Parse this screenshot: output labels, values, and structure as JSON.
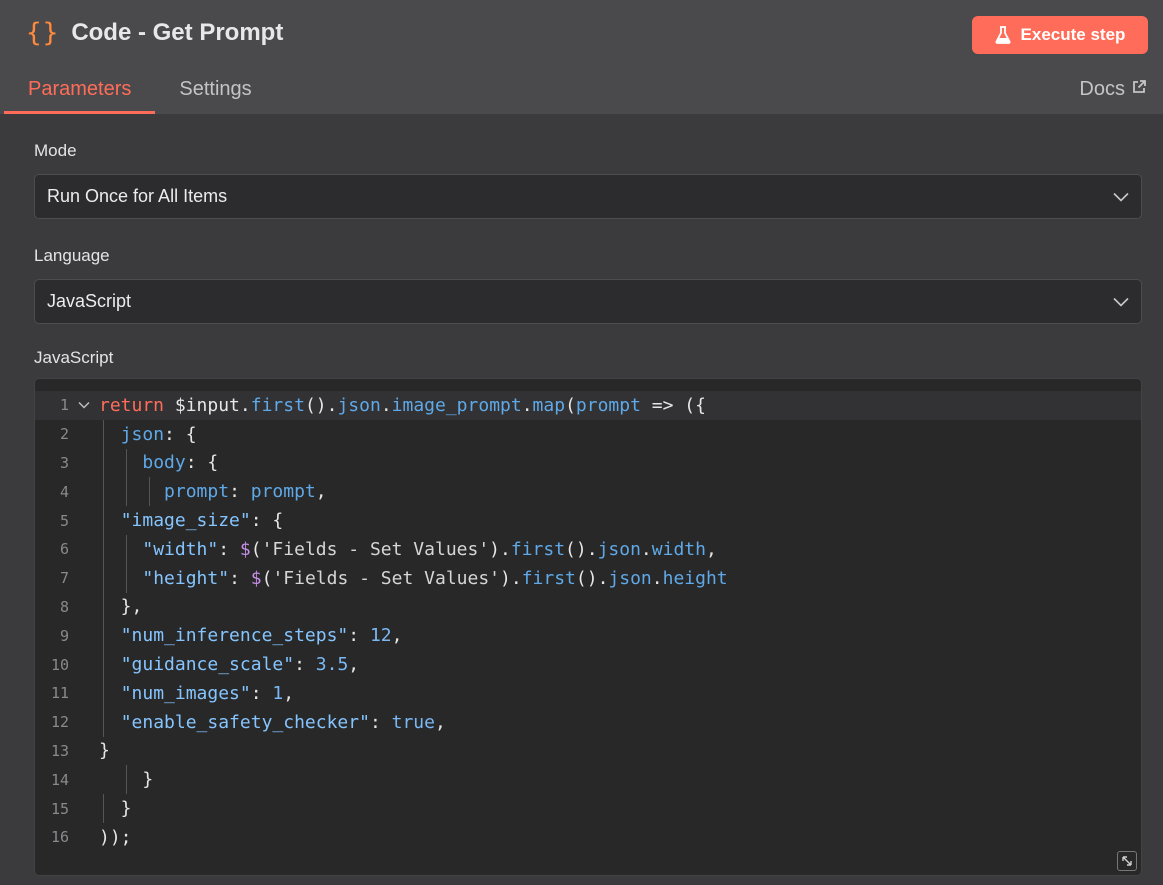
{
  "header": {
    "icon": "code-braces-icon",
    "icon_glyph": "{}",
    "title": "Code - Get Prompt",
    "execute_label": "Execute step",
    "accent": "#ff6d5a"
  },
  "tabs": [
    {
      "label": "Parameters",
      "active": true
    },
    {
      "label": "Settings",
      "active": false
    }
  ],
  "docs_label": "Docs",
  "mode": {
    "label": "Mode",
    "value": "Run Once for All Items"
  },
  "language": {
    "label": "Language",
    "value": "JavaScript"
  },
  "editor": {
    "label": "JavaScript",
    "lines": [
      {
        "n": "1",
        "text": "return $input.first().json.image_prompt.map(prompt => ({"
      },
      {
        "n": "2",
        "text": "  json: {"
      },
      {
        "n": "3",
        "text": "    body: {"
      },
      {
        "n": "4",
        "text": "      prompt: prompt,"
      },
      {
        "n": "5",
        "text": "  \"image_size\": {"
      },
      {
        "n": "6",
        "text": "    \"width\": $('Fields - Set Values').first().json.width,"
      },
      {
        "n": "7",
        "text": "    \"height\": $('Fields - Set Values').first().json.height"
      },
      {
        "n": "8",
        "text": "  },"
      },
      {
        "n": "9",
        "text": "  \"num_inference_steps\": 12,"
      },
      {
        "n": "10",
        "text": "  \"guidance_scale\": 3.5,"
      },
      {
        "n": "11",
        "text": "  \"num_images\": 1,"
      },
      {
        "n": "12",
        "text": "  \"enable_safety_checker\": true,"
      },
      {
        "n": "13",
        "text": "}"
      },
      {
        "n": "14",
        "text": "    }"
      },
      {
        "n": "15",
        "text": "  }"
      },
      {
        "n": "16",
        "text": "));"
      }
    ]
  }
}
